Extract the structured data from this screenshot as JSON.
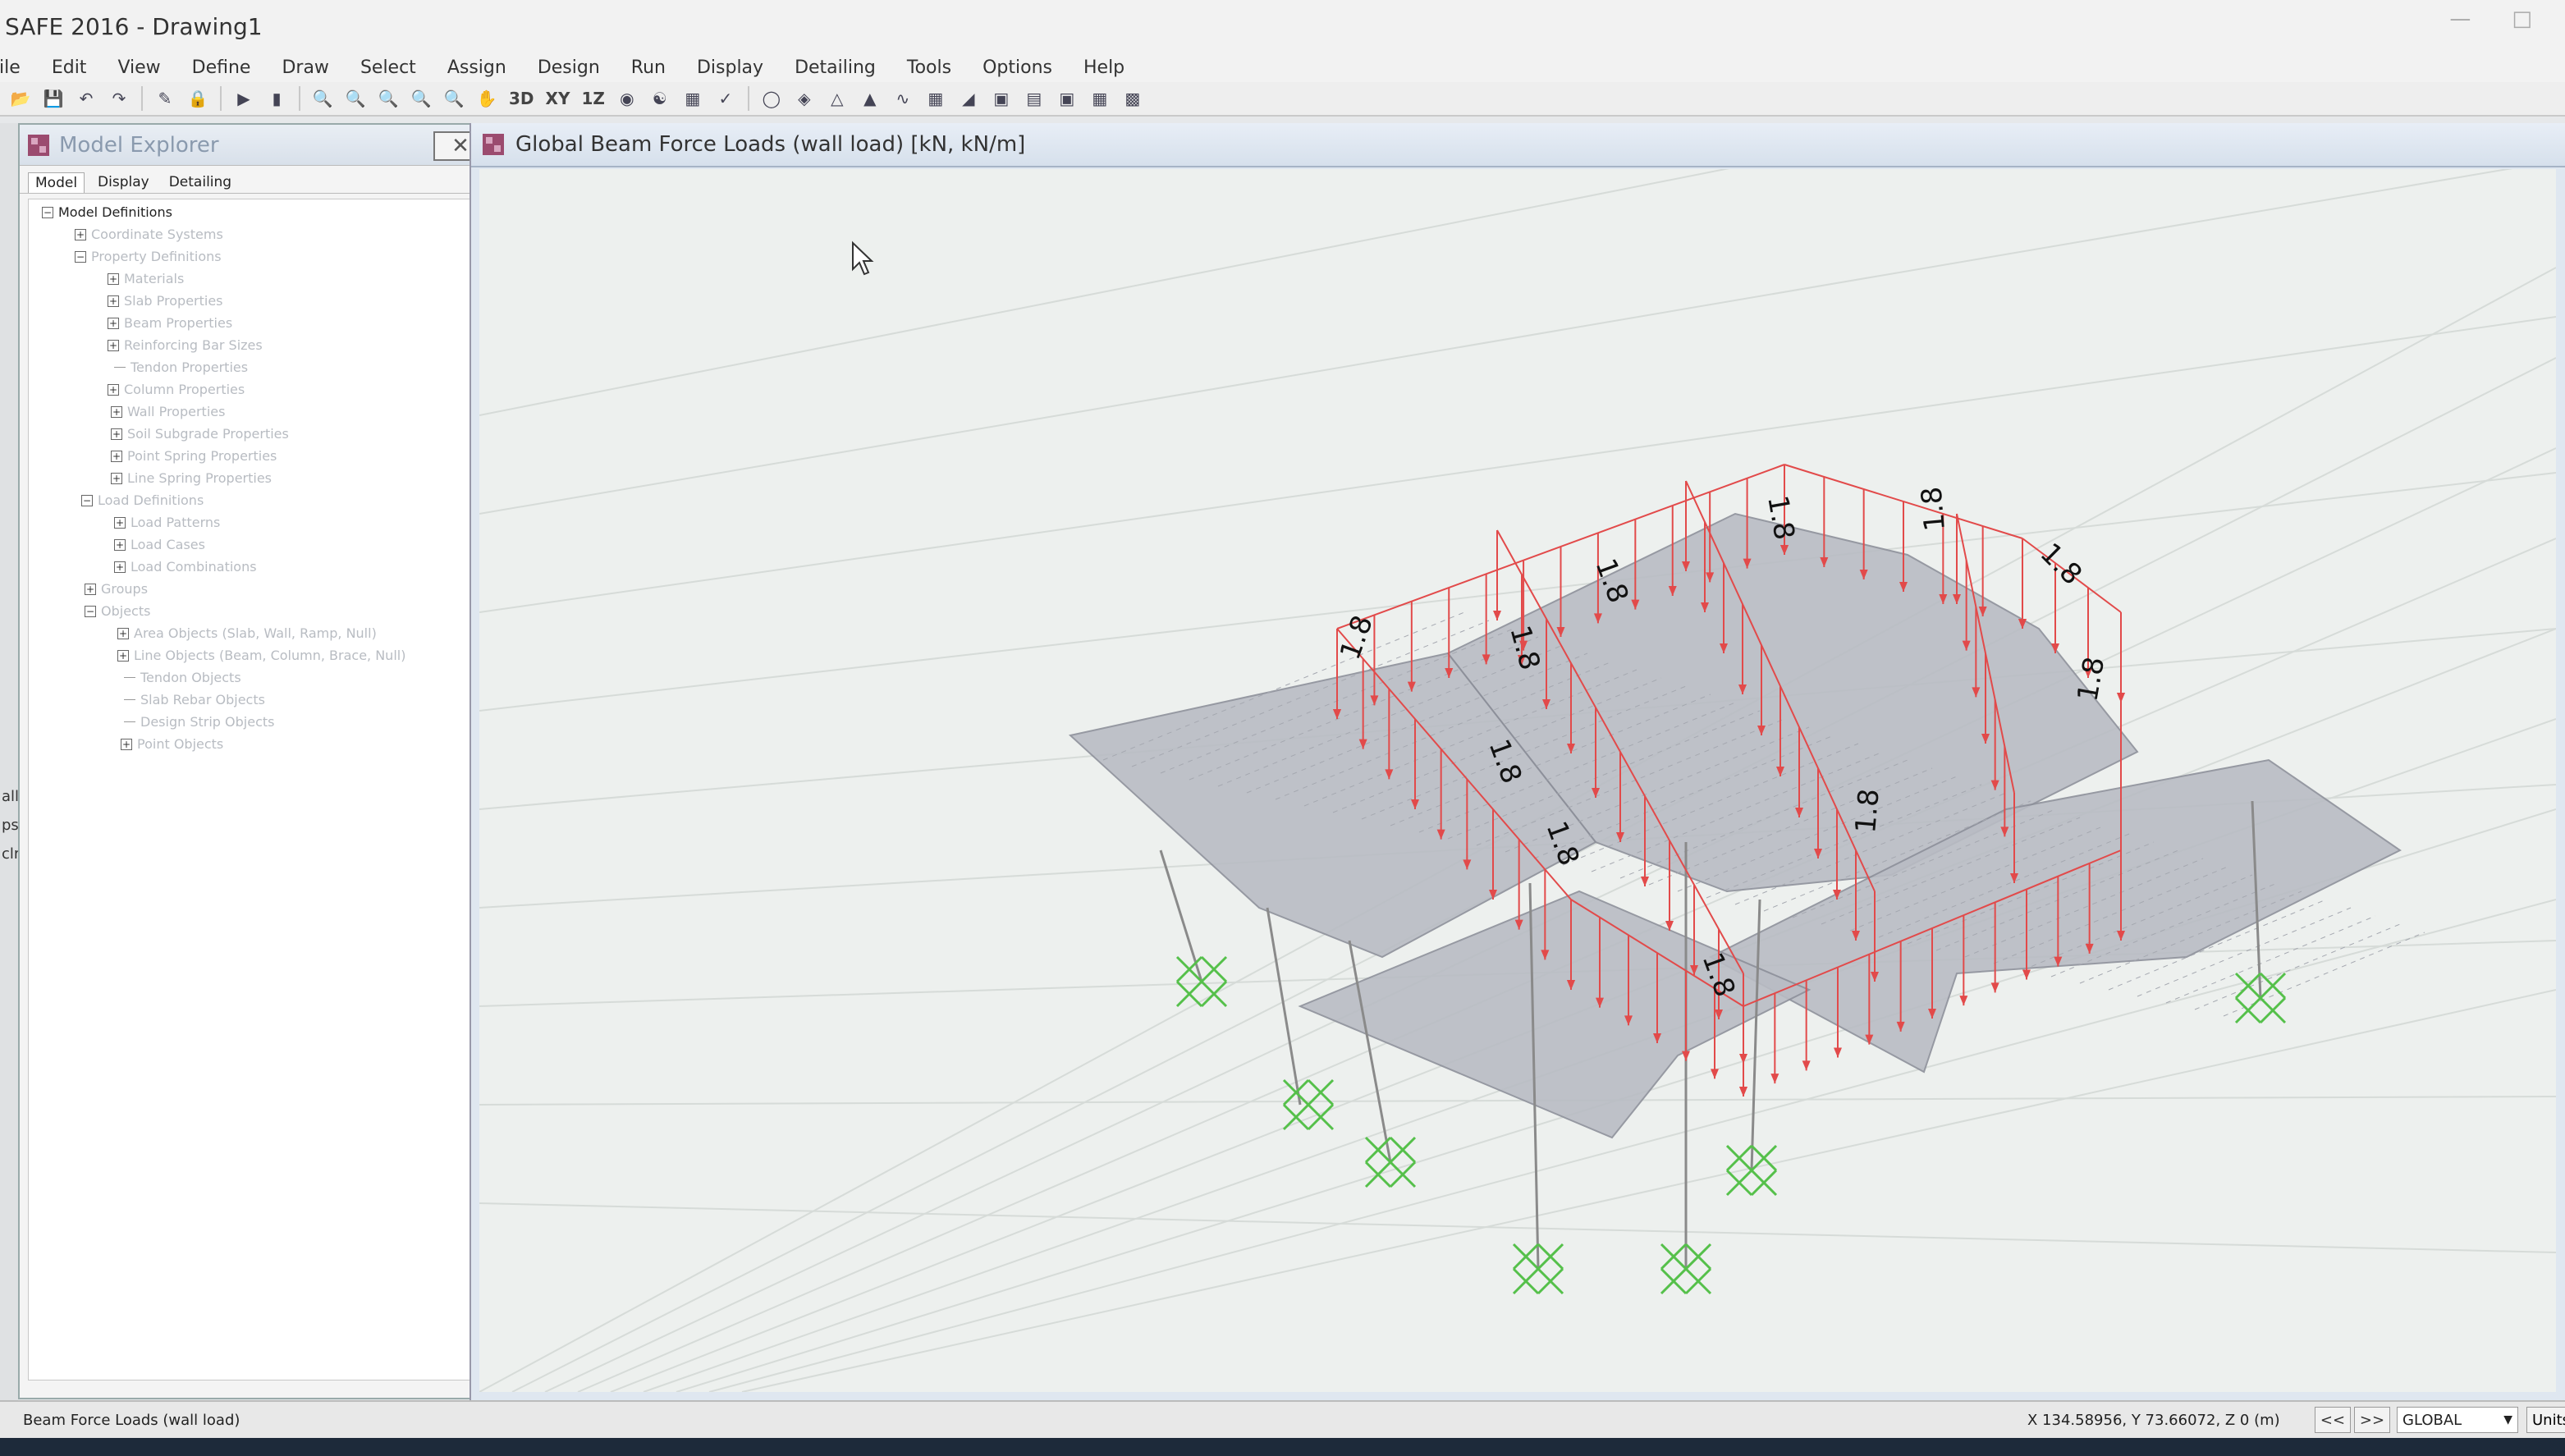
{
  "app": {
    "title": "SAFE 2016 - Drawing1"
  },
  "menu": [
    "File",
    "Edit",
    "View",
    "Define",
    "Draw",
    "Select",
    "Assign",
    "Design",
    "Run",
    "Display",
    "Detailing",
    "Tools",
    "Options",
    "Help"
  ],
  "toolbar": {
    "view_3d": "3D",
    "view_xy": "XY",
    "view_1z": "1Z"
  },
  "explorer": {
    "title": "Model Explorer",
    "tabs": [
      "Model",
      "Display",
      "Detailing"
    ],
    "tree": [
      "Model Definitions",
      "Coordinate Systems",
      "Property Definitions",
      "Materials",
      "Slab Properties",
      "Beam Properties",
      "Reinforcing Bar Sizes",
      "Tendon Properties",
      "Column Properties",
      "Wall Properties",
      "Soil Subgrade Properties",
      "Point Spring Properties",
      "Line Spring Properties",
      "Load Definitions",
      "Load Patterns",
      "Load Cases",
      "Load Combinations",
      "Groups",
      "Objects",
      "Area Objects (Slab, Wall, Ramp, Null)",
      "Line Objects (Beam, Column, Brace, Null)",
      "Tendon Objects",
      "Slab Rebar Objects",
      "Design Strip Objects",
      "Point Objects"
    ]
  },
  "left_strip": [
    "all",
    "ps",
    "clr"
  ],
  "canvas": {
    "title": "Global Beam Force Loads (wall load)  [kN,  kN/m]",
    "load_value": "1.8",
    "colors": {
      "load": "#e24a4a",
      "support": "#55c04a",
      "slab": "#b9bcc4",
      "column": "#8a8a8a"
    }
  },
  "status": {
    "message": "Beam Force Loads  (wall load)",
    "coords": "X 134.58956,  Y 73.66072,  Z 0  (m)",
    "prev": "<<",
    "next": ">>",
    "coord_system": "GLOBAL",
    "units": "Units"
  }
}
